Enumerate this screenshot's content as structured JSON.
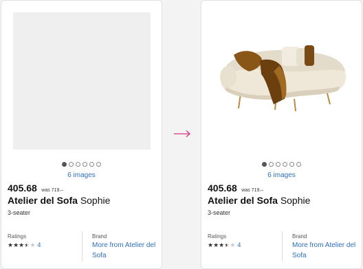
{
  "cards": [
    {
      "images_label": "6 images",
      "price": "405.68",
      "was_price": "was 719.–",
      "brand": "Atelier del Sofa",
      "model": "Sophie",
      "variant": "3-seater",
      "ratings_label": "Ratings",
      "rating_value": 3.5,
      "rating_count": "4",
      "brand_label": "Brand",
      "brand_link": "More from Atelier del Sofa"
    },
    {
      "images_label": "6 images",
      "price": "405.68",
      "was_price": "was 719.–",
      "brand": "Atelier del Sofa",
      "model": "Sophie",
      "variant": "3-seater",
      "ratings_label": "Ratings",
      "rating_value": 3.5,
      "rating_count": "4",
      "brand_label": "Brand",
      "brand_link": "More from Atelier del Sofa"
    }
  ],
  "carousel": {
    "total": 6,
    "active_index": 0
  },
  "colors": {
    "accent": "#2e6fbd",
    "arrow": "#d63384",
    "placeholder": "#efefef"
  },
  "icons": {
    "transition": "arrow-right-icon",
    "rating": "star-icon"
  }
}
